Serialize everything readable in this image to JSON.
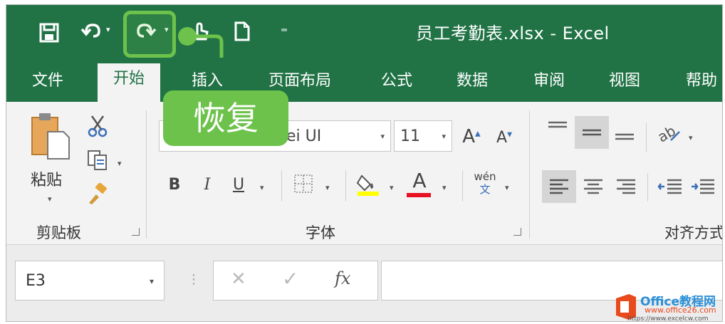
{
  "window": {
    "title": "员工考勤表.xlsx  -  Excel"
  },
  "qat": {
    "dropdown_glyph": "▾",
    "customize_glyph": "⁼"
  },
  "tabs": [
    "文件",
    "开始",
    "插入",
    "页面布局",
    "公式",
    "数据",
    "审阅",
    "视图",
    "帮助"
  ],
  "clipboard": {
    "paste_label": "粘贴",
    "group_label": "剪贴板"
  },
  "font": {
    "font_name": "Microsoft YaHei UI",
    "font_name_visible": "ei UI",
    "font_size": "11",
    "group_label": "字体",
    "bold": "B",
    "italic": "I",
    "underline": "U",
    "grow": "A",
    "shrink": "A",
    "pinyin_top": "wén",
    "pinyin_bottom": "文",
    "font_color": "A",
    "fill_color_hex": "#ffff00",
    "font_color_hex": "#e81123"
  },
  "alignment": {
    "group_label": "对齐方式",
    "group_label_visible": "对齐方式"
  },
  "formula_bar": {
    "name_box": "E3",
    "cancel": "✕",
    "enter": "✓",
    "fx": "fx"
  },
  "callout": {
    "label": "恢复",
    "color": "#6cc24a"
  },
  "watermark": {
    "line1": "Office教程网",
    "line2": "www.office26.com",
    "line3": "https://www.excelcw.com"
  },
  "colors": {
    "excel_green": "#217346",
    "ribbon_bg": "#f3f3f3"
  },
  "icons": [
    "save-icon",
    "undo-icon",
    "redo-icon",
    "new-file-icon",
    "cut-icon",
    "copy-icon",
    "format-painter-icon",
    "borders-icon",
    "fill-color-icon",
    "font-color-icon",
    "align-left-icon",
    "decrease-indent-icon",
    "increase-indent-icon",
    "orientation-icon"
  ]
}
